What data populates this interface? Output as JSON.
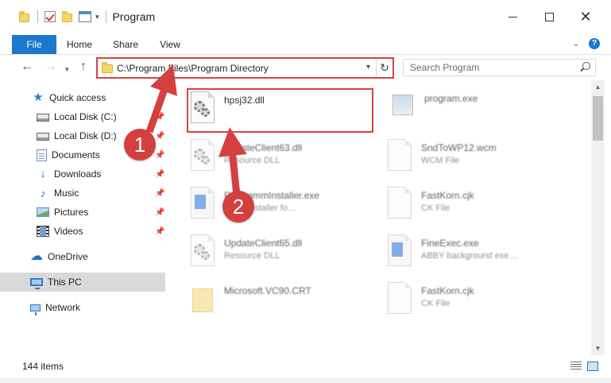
{
  "window": {
    "title": "Program",
    "quick_access_toolbar": [
      "folder-icon",
      "properties-check-icon",
      "new-folder-icon",
      "customize-icon"
    ],
    "controls": [
      "minimize",
      "maximize",
      "close"
    ]
  },
  "ribbon": {
    "tabs": [
      {
        "label": "File",
        "active": true
      },
      {
        "label": "Home"
      },
      {
        "label": "Share"
      },
      {
        "label": "View"
      }
    ]
  },
  "nav": {
    "address": "C:\\Program Files\\Program Directory",
    "search_placeholder": "Search Program"
  },
  "sidebar": {
    "items": [
      {
        "label": "Quick access",
        "icon": "star-icon",
        "pinned": false
      },
      {
        "label": "Local Disk (C:)",
        "icon": "disk-icon",
        "pinned": true
      },
      {
        "label": "Local Disk (D:)",
        "icon": "disk-icon",
        "pinned": true
      },
      {
        "label": "Documents",
        "icon": "documents-icon",
        "pinned": true
      },
      {
        "label": "Downloads",
        "icon": "downloads-icon",
        "pinned": true
      },
      {
        "label": "Music",
        "icon": "music-icon",
        "pinned": true
      },
      {
        "label": "Pictures",
        "icon": "pictures-icon",
        "pinned": true
      },
      {
        "label": "Videos",
        "icon": "videos-icon",
        "pinned": true
      },
      {
        "label": "OneDrive",
        "icon": "onedrive-icon",
        "pinned": false
      },
      {
        "label": "This PC",
        "icon": "this-pc-icon",
        "pinned": false,
        "selected": true
      },
      {
        "label": "Network",
        "icon": "network-icon",
        "pinned": false
      }
    ]
  },
  "files": [
    {
      "name": "hpsj32.dll",
      "type": "",
      "icon": "dll-gear-icon",
      "highlighted": true
    },
    {
      "name": "program.exe",
      "type": "",
      "icon": "exe-icon"
    },
    {
      "name": "UpdateClient63.dll",
      "type": "Resource DLL",
      "icon": "dll-gear-icon"
    },
    {
      "name": "SndToWP12.wcm",
      "type": "WCM File",
      "icon": "blank-file-icon"
    },
    {
      "name": "ProgrammInstaller.exe",
      "type": "Prog. Installer fo…",
      "icon": "installer-icon"
    },
    {
      "name": "FastKorn.cjk",
      "type": "CK File",
      "icon": "blank-file-icon"
    },
    {
      "name": "UpdateClient65.dll",
      "type": "Resource DLL",
      "icon": "dll-gear-icon"
    },
    {
      "name": "FineExec.exe",
      "type": "ABBY background exe…",
      "icon": "installer-icon"
    },
    {
      "name": "Microsoft.VC90.CRT",
      "type": "",
      "icon": "folder-icon"
    },
    {
      "name": "FastKorn.cjk",
      "type": "CK File",
      "icon": "blank-file-icon"
    }
  ],
  "status": {
    "item_count": "144 items"
  },
  "annotations": [
    {
      "number": "1"
    },
    {
      "number": "2"
    }
  ],
  "colors": {
    "accent": "#1979ca",
    "annotation_red": "#d43f3f",
    "selection": "#d9d9d9"
  }
}
